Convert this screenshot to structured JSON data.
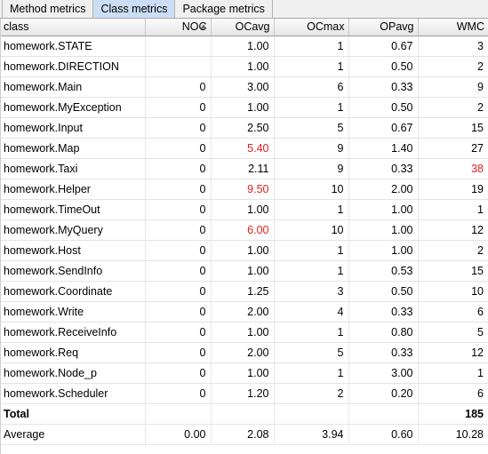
{
  "tabs": [
    {
      "label": "Method metrics",
      "selected": false
    },
    {
      "label": "Class metrics",
      "selected": true
    },
    {
      "label": "Package metrics",
      "selected": false
    }
  ],
  "table": {
    "sort_column": "NOC",
    "sort_direction": "ascending",
    "columns": [
      {
        "key": "class",
        "label": "class",
        "align": "left"
      },
      {
        "key": "noc",
        "label": "NOC",
        "align": "right"
      },
      {
        "key": "ocavg",
        "label": "OCavg",
        "align": "right"
      },
      {
        "key": "ocmax",
        "label": "OCmax",
        "align": "right"
      },
      {
        "key": "opavg",
        "label": "OPavg",
        "align": "right"
      },
      {
        "key": "wmc",
        "label": "WMC",
        "align": "right"
      }
    ],
    "rows": [
      {
        "class": "homework.STATE",
        "noc": "",
        "ocavg": "1.00",
        "ocmax": "1",
        "opavg": "0.67",
        "wmc": "3",
        "warn": []
      },
      {
        "class": "homework.DIRECTION",
        "noc": "",
        "ocavg": "1.00",
        "ocmax": "1",
        "opavg": "0.50",
        "wmc": "2",
        "warn": []
      },
      {
        "class": "homework.Main",
        "noc": "0",
        "ocavg": "3.00",
        "ocmax": "6",
        "opavg": "0.33",
        "wmc": "9",
        "warn": []
      },
      {
        "class": "homework.MyException",
        "noc": "0",
        "ocavg": "1.00",
        "ocmax": "1",
        "opavg": "0.50",
        "wmc": "2",
        "warn": []
      },
      {
        "class": "homework.Input",
        "noc": "0",
        "ocavg": "2.50",
        "ocmax": "5",
        "opavg": "0.67",
        "wmc": "15",
        "warn": []
      },
      {
        "class": "homework.Map",
        "noc": "0",
        "ocavg": "5.40",
        "ocmax": "9",
        "opavg": "1.40",
        "wmc": "27",
        "warn": [
          "ocavg"
        ]
      },
      {
        "class": "homework.Taxi",
        "noc": "0",
        "ocavg": "2.11",
        "ocmax": "9",
        "opavg": "0.33",
        "wmc": "38",
        "warn": [
          "wmc"
        ]
      },
      {
        "class": "homework.Helper",
        "noc": "0",
        "ocavg": "9.50",
        "ocmax": "10",
        "opavg": "2.00",
        "wmc": "19",
        "warn": [
          "ocavg"
        ]
      },
      {
        "class": "homework.TimeOut",
        "noc": "0",
        "ocavg": "1.00",
        "ocmax": "1",
        "opavg": "1.00",
        "wmc": "1",
        "warn": []
      },
      {
        "class": "homework.MyQuery",
        "noc": "0",
        "ocavg": "6.00",
        "ocmax": "10",
        "opavg": "1.00",
        "wmc": "12",
        "warn": [
          "ocavg"
        ]
      },
      {
        "class": "homework.Host",
        "noc": "0",
        "ocavg": "1.00",
        "ocmax": "1",
        "opavg": "1.00",
        "wmc": "2",
        "warn": []
      },
      {
        "class": "homework.SendInfo",
        "noc": "0",
        "ocavg": "1.00",
        "ocmax": "1",
        "opavg": "0.53",
        "wmc": "15",
        "warn": []
      },
      {
        "class": "homework.Coordinate",
        "noc": "0",
        "ocavg": "1.25",
        "ocmax": "3",
        "opavg": "0.50",
        "wmc": "10",
        "warn": []
      },
      {
        "class": "homework.Write",
        "noc": "0",
        "ocavg": "2.00",
        "ocmax": "4",
        "opavg": "0.33",
        "wmc": "6",
        "warn": []
      },
      {
        "class": "homework.ReceiveInfo",
        "noc": "0",
        "ocavg": "1.00",
        "ocmax": "1",
        "opavg": "0.80",
        "wmc": "5",
        "warn": []
      },
      {
        "class": "homework.Req",
        "noc": "0",
        "ocavg": "2.00",
        "ocmax": "5",
        "opavg": "0.33",
        "wmc": "12",
        "warn": []
      },
      {
        "class": "homework.Node_p",
        "noc": "0",
        "ocavg": "1.00",
        "ocmax": "1",
        "opavg": "3.00",
        "wmc": "1",
        "warn": []
      },
      {
        "class": "homework.Scheduler",
        "noc": "0",
        "ocavg": "1.20",
        "ocmax": "2",
        "opavg": "0.20",
        "wmc": "6",
        "warn": []
      }
    ],
    "summary_rows": [
      {
        "class": "Total",
        "noc": "",
        "ocavg": "",
        "ocmax": "",
        "opavg": "",
        "wmc": "185",
        "bold": true
      },
      {
        "class": "Average",
        "noc": "0.00",
        "ocavg": "2.08",
        "ocmax": "3.94",
        "opavg": "0.60",
        "wmc": "10.28",
        "bold": false
      }
    ]
  },
  "colors": {
    "tab_selected_bg": "#cbdef5",
    "warning_text": "#e02020",
    "header_bg": "#f1f1f1",
    "grid_line": "#e3e3e3"
  }
}
